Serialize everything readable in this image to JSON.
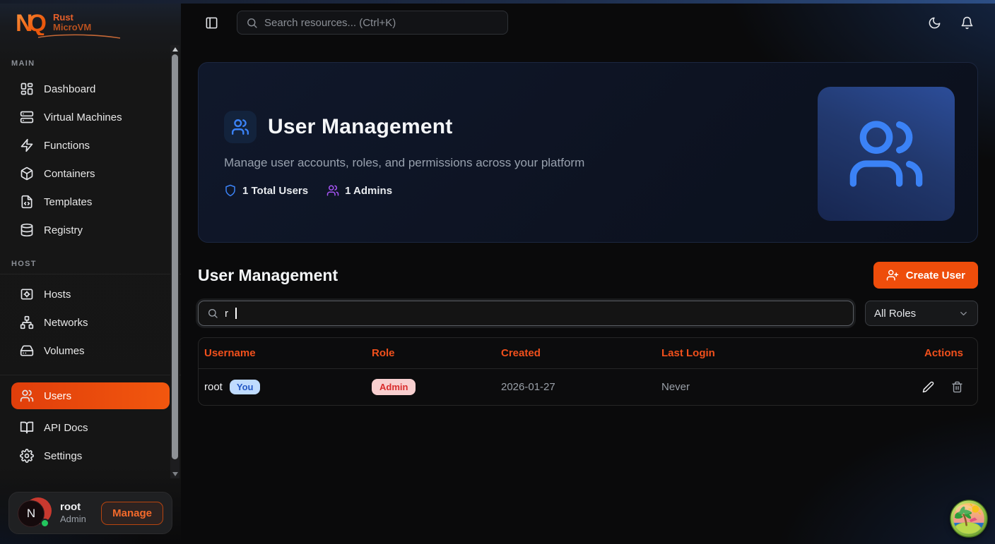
{
  "brand": {
    "logo_text": "NQ",
    "name_top": "Rust",
    "name_bottom": "MicroVM"
  },
  "topbar": {
    "search_placeholder": "Search resources... (Ctrl+K)"
  },
  "sidebar": {
    "sections": [
      {
        "label": "MAIN",
        "items": [
          {
            "label": "Dashboard",
            "icon": "dashboard-icon"
          },
          {
            "label": "Virtual Machines",
            "icon": "server-icon"
          },
          {
            "label": "Functions",
            "icon": "zap-icon"
          },
          {
            "label": "Containers",
            "icon": "box-icon"
          },
          {
            "label": "Templates",
            "icon": "file-code-icon"
          },
          {
            "label": "Registry",
            "icon": "database-icon"
          }
        ]
      },
      {
        "label": "HOST",
        "items": [
          {
            "label": "Hosts",
            "icon": "host-icon"
          },
          {
            "label": "Networks",
            "icon": "network-icon"
          },
          {
            "label": "Volumes",
            "icon": "hard-drive-icon"
          }
        ]
      },
      {
        "label": "",
        "items": [
          {
            "label": "Users",
            "icon": "users-icon",
            "active": true
          },
          {
            "label": "API Docs",
            "icon": "book-open-icon"
          },
          {
            "label": "Settings",
            "icon": "gear-icon"
          }
        ]
      }
    ],
    "user_card": {
      "name": "root",
      "role": "Admin",
      "avatar_letter": "N",
      "manage_label": "Manage"
    }
  },
  "hero": {
    "title": "User Management",
    "subtitle": "Manage user accounts, roles, and permissions across your platform",
    "stats": [
      {
        "label": "1 Total Users",
        "icon": "shield-icon",
        "color": "#3b82f6"
      },
      {
        "label": "1 Admins",
        "icon": "users-icon",
        "color": "#a855f7"
      }
    ]
  },
  "content": {
    "heading": "User Management",
    "create_button_label": "Create User",
    "search_value": "r",
    "roles_filter_value": "All Roles"
  },
  "table": {
    "headers": {
      "username": "Username",
      "role": "Role",
      "created": "Created",
      "last_login": "Last Login",
      "actions": "Actions"
    },
    "rows": [
      {
        "username": "root",
        "you_badge": "You",
        "role_badge": "Admin",
        "created": "2026-01-27",
        "last_login": "Never"
      }
    ]
  },
  "colors": {
    "accent_orange": "#ee4d0b",
    "header_orange": "#f1501c",
    "blue": "#3b82f6",
    "purple": "#a855f7",
    "you_badge_bg": "#bfdbfe",
    "you_badge_text": "#2458c5",
    "admin_badge_bg": "#f8cfcf",
    "admin_badge_text": "#d92d2d",
    "online_green": "#22c55e"
  }
}
